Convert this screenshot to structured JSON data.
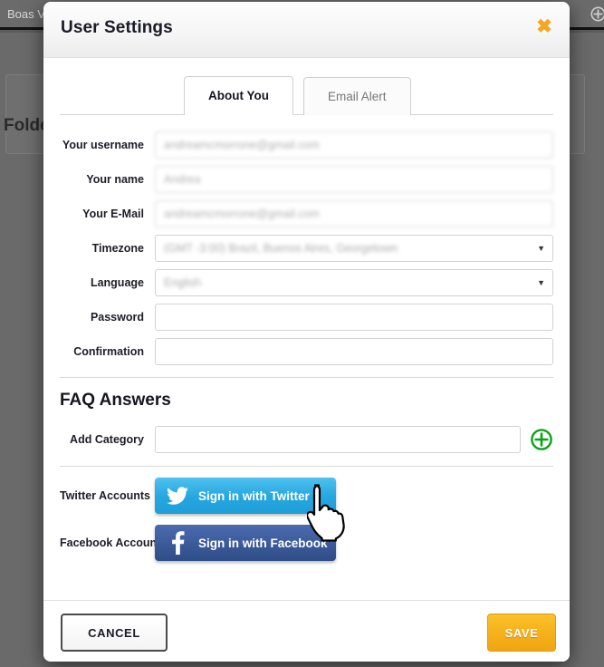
{
  "background": {
    "tab_label": "Boas V",
    "panel_label": "Folder",
    "plus_icon": "plus-circle-icon"
  },
  "modal": {
    "title": "User Settings",
    "close_label": "✖",
    "close_icon": "close-icon",
    "accent_orange": "#f5a623",
    "tabs": [
      {
        "label": "About You",
        "active": true
      },
      {
        "label": "Email Alert",
        "active": false
      }
    ],
    "form": {
      "fields": [
        {
          "label": "Your username",
          "value": "andreamcmorrone@gmail.com",
          "type": "text",
          "blurred": true
        },
        {
          "label": "Your name",
          "value": "Andrea",
          "type": "text",
          "blurred": true
        },
        {
          "label": "Your E-Mail",
          "value": "andreamcmorrone@gmail.com",
          "type": "text",
          "blurred": true
        },
        {
          "label": "Timezone",
          "value": "(GMT -3:00) Brazil, Buenos Aires, Georgetown",
          "type": "select",
          "arrow": "▼"
        },
        {
          "label": "Language",
          "value": "English",
          "type": "select",
          "arrow": "▼"
        },
        {
          "label": "Password",
          "value": "",
          "type": "password",
          "blurred": false
        },
        {
          "label": "Confirmation",
          "value": "",
          "type": "password",
          "blurred": false
        }
      ]
    },
    "faq": {
      "title": "FAQ Answers",
      "add_category_label": "Add Category",
      "add_category_value": "",
      "add_button_icon": "plus-circle-icon",
      "add_button_color": "#0aa21a"
    },
    "social": {
      "twitter_label": "Twitter Accounts",
      "twitter_button": "Sign in with Twitter",
      "twitter_icon": "twitter-bird-icon",
      "twitter_color": "#27a7e0",
      "facebook_label": "Facebook Account",
      "facebook_button": "Sign in with Facebook",
      "facebook_icon": "facebook-f-icon",
      "facebook_color": "#3a5a98"
    },
    "footer": {
      "cancel_label": "CANCEL",
      "save_label": "SAVE",
      "save_color": "#f6b11b"
    }
  },
  "cursor": {
    "icon": "hand-pointer-cursor"
  }
}
